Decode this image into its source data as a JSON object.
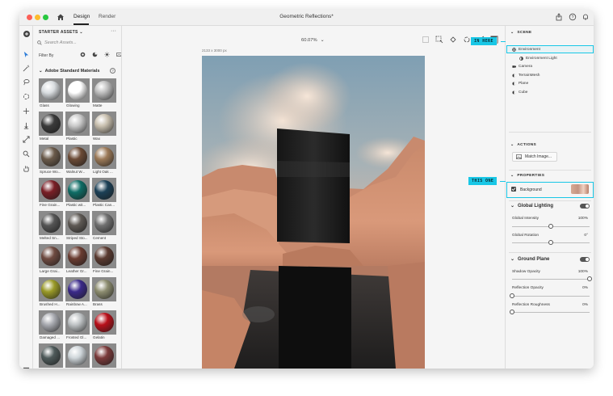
{
  "titlebar": {
    "tabs": [
      "Design",
      "Render"
    ],
    "active_tab": "Design",
    "document_title": "Geometric Reflections*"
  },
  "assets": {
    "header": "STARTER ASSETS",
    "search_placeholder": "Search Assets...",
    "filter_label": "Filter By",
    "section_title": "Adobe Standard Materials",
    "help_glyph": "?",
    "materials": [
      {
        "name": "Glass",
        "color": "#d9dde0"
      },
      {
        "name": "Glowing",
        "color": "#ffffff"
      },
      {
        "name": "Matte",
        "color": "#bdbdbd"
      },
      {
        "name": "Metal",
        "color": "#3a3a3a"
      },
      {
        "name": "Plastic",
        "color": "#c9c9c9"
      },
      {
        "name": "Wax",
        "color": "#c8bfae"
      },
      {
        "name": "Spruce Wo...",
        "color": "#6a5a4a"
      },
      {
        "name": "Walnut W...",
        "color": "#6b4a35"
      },
      {
        "name": "Light Oak ...",
        "color": "#9c7a58"
      },
      {
        "name": "Fine Grain...",
        "color": "#7a1f26"
      },
      {
        "name": "Plastic wit...",
        "color": "#0f6d66"
      },
      {
        "name": "Plastic Can...",
        "color": "#1c4056"
      },
      {
        "name": "Melted Sn...",
        "color": "#555555"
      },
      {
        "name": "Striped Sto...",
        "color": "#5f5a55"
      },
      {
        "name": "Cement",
        "color": "#707070"
      },
      {
        "name": "Large Grai...",
        "color": "#6e4a40"
      },
      {
        "name": "Leather Gr...",
        "color": "#6a3c31"
      },
      {
        "name": "Fine Grain...",
        "color": "#5a3a30"
      },
      {
        "name": "Brushed H...",
        "color": "#9a9a28"
      },
      {
        "name": "Rainbow A...",
        "color": "#3b2a8a"
      },
      {
        "name": "Brass",
        "color": "#8d8d70"
      },
      {
        "name": "Damaged ...",
        "color": "#a8aab0"
      },
      {
        "name": "Frosted Gl...",
        "color": "#bfc3c5"
      },
      {
        "name": "Gelatin",
        "color": "#b8101a"
      },
      {
        "name": "Glitter",
        "color": "#4e5a5a"
      },
      {
        "name": "Ice",
        "color": "#cfd6da"
      },
      {
        "name": "Vintage Gl...",
        "color": "#7a3a3a"
      }
    ]
  },
  "canvas": {
    "zoom": "60.07%",
    "dimensions": "2133 x 3000 px"
  },
  "scene": {
    "header": "SCENE",
    "items": [
      {
        "label": "Environment",
        "icon": "environment-icon",
        "indent": 0
      },
      {
        "label": "Environment Light",
        "icon": "light-icon",
        "indent": 1
      },
      {
        "label": "Camera",
        "icon": "camera-icon",
        "indent": 0
      },
      {
        "label": "TerrainMesh",
        "icon": "mesh-icon",
        "indent": 0
      },
      {
        "label": "Plane",
        "icon": "mesh-icon",
        "indent": 0
      },
      {
        "label": "Cube",
        "icon": "mesh-icon",
        "indent": 0
      }
    ]
  },
  "actions": {
    "header": "ACTIONS",
    "match_image": "Match Image..."
  },
  "properties": {
    "header": "PROPERTIES",
    "background_label": "Background",
    "background_checked": true
  },
  "global_lighting": {
    "title": "Global Lighting",
    "enabled": true,
    "intensity_label": "Global Intensity",
    "intensity_value": "100%",
    "intensity_fraction": 0.5,
    "rotation_label": "Global Rotation",
    "rotation_value": "0°",
    "rotation_fraction": 0.5
  },
  "ground_plane": {
    "title": "Ground Plane",
    "enabled": true,
    "shadow_label": "Shadow Opacity",
    "shadow_value": "100%",
    "shadow_fraction": 1.0,
    "refl_opacity_label": "Reflection Opacity",
    "refl_opacity_value": "0%",
    "refl_opacity_fraction": 0.0,
    "refl_rough_label": "Reflection Roughness",
    "refl_rough_value": "0%",
    "refl_rough_fraction": 0.0
  },
  "callouts": {
    "in_here": "IN HERE",
    "this_one": "THIS ONE"
  },
  "colors": {
    "accent_cyan": "#19c7e6"
  }
}
